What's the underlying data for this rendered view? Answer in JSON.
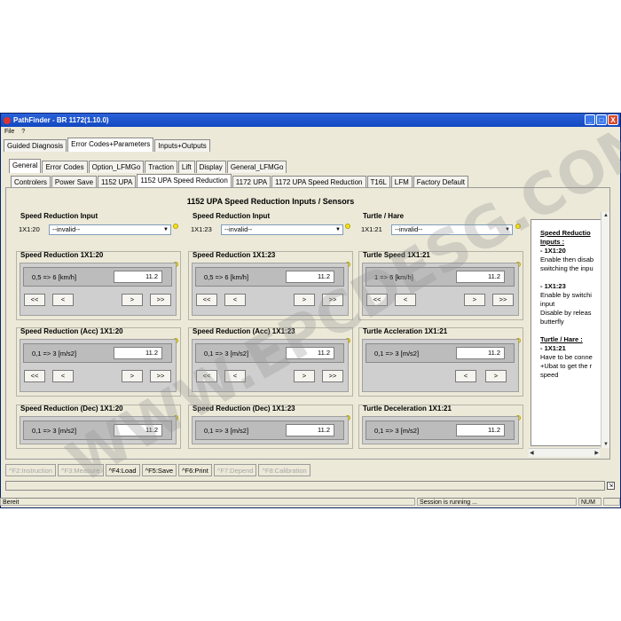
{
  "window": {
    "title": "PathFinder - BR 1172(1.10.0)",
    "buttons": [
      "_",
      "□",
      "X"
    ]
  },
  "menu": [
    "File",
    "?"
  ],
  "top_tabs": [
    "Guided Diagnosis",
    "Error Codes+Parameters",
    "Inputs+Outputs"
  ],
  "second_tabs": [
    "General",
    "Error Codes",
    "Option_LFMGo",
    "Traction",
    "Lift",
    "Display",
    "General_LFMGo"
  ],
  "third_tabs": [
    "Controlers",
    "Power Save",
    "1152 UPA",
    "1152 UPA Speed Reduction",
    "1172 UPA",
    "1172 UPA Speed Reduction",
    "T16L",
    "LFM",
    "Factory Default"
  ],
  "heading": "1152 UPA Speed Reduction Inputs / Sensors",
  "inputs": [
    {
      "title": "Speed Reduction Input",
      "port": "1X1:20",
      "value": "--invalid--"
    },
    {
      "title": "Speed Reduction Input",
      "port": "1X1:23",
      "value": "--invalid--"
    },
    {
      "title": "Turtle / Hare",
      "port": "1X1:21",
      "value": "--invalid--"
    }
  ],
  "panels": [
    {
      "title": "Speed Reduction 1X1:20",
      "range": "0,5 => 6 [km/h]",
      "value": "11.2"
    },
    {
      "title": "Speed Reduction 1X1:23",
      "range": "0,5 => 6 [km/h]",
      "value": "11.2"
    },
    {
      "title": "Turtle Speed 1X1:21",
      "range": "1 => 6 [km/h]",
      "value": "11.2"
    },
    {
      "title": "Speed Reduction (Acc) 1X1:20",
      "range": "0,1 => 3 [m/s2]",
      "value": "11.2"
    },
    {
      "title": "Speed Reduction (Acc) 1X1:23",
      "range": "0,1 => 3 [m/s2]",
      "value": "11.2"
    },
    {
      "title": "Turtle Accleration 1X1:21",
      "range": "0,1 => 3 [m/s2]",
      "value": "11.2"
    },
    {
      "title": "Speed Reduction (Dec) 1X1:20",
      "range": "0,1 => 3 [m/s2]",
      "value": "11.2"
    },
    {
      "title": "Speed Reduction (Dec) 1X1:23",
      "range": "0,1 => 3 [m/s2]",
      "value": "11.2"
    },
    {
      "title": "Turtle Deceleration 1X1:21",
      "range": "0,1 => 3 [m/s2]",
      "value": "11.2"
    }
  ],
  "nav_buttons": {
    "first": "<<",
    "prev": "<",
    "next": ">",
    "last": ">>"
  },
  "help": [
    {
      "text": "Speed Reductio",
      "style": "bold u"
    },
    {
      "text": "Inputs :",
      "style": "bold u"
    },
    {
      "text": "- 1X1:20",
      "style": "bold"
    },
    {
      "text": "Enable then disab",
      "style": ""
    },
    {
      "text": "switching the inpu",
      "style": ""
    },
    {
      "text": "",
      "style": ""
    },
    {
      "text": "- 1X1:23",
      "style": "bold"
    },
    {
      "text": "Enable by switchi",
      "style": ""
    },
    {
      "text": "input",
      "style": ""
    },
    {
      "text": "Disable by releas",
      "style": ""
    },
    {
      "text": "butterfly",
      "style": ""
    },
    {
      "text": "",
      "style": ""
    },
    {
      "text": "Turtle / Hare :",
      "style": "bold u"
    },
    {
      "text": "- 1X1:21",
      "style": "bold"
    },
    {
      "text": "Have to be conne",
      "style": ""
    },
    {
      "text": "+Ubat to get the r",
      "style": ""
    },
    {
      "text": "speed",
      "style": ""
    }
  ],
  "fkeys": [
    {
      "label": "^F2:Instruction",
      "enabled": false
    },
    {
      "label": "^F3:Measure",
      "enabled": false
    },
    {
      "label": "^F4:Load",
      "enabled": true
    },
    {
      "label": "^F5:Save",
      "enabled": true
    },
    {
      "label": "^F6:Print",
      "enabled": true
    },
    {
      "label": "^F7:Depend",
      "enabled": false
    },
    {
      "label": "^F8:Calibration",
      "enabled": false
    }
  ],
  "status": {
    "left": "Bereit",
    "middle": "Session is running ...",
    "num": "NUM"
  },
  "watermark": "WWW.EPCDESG.COM",
  "colors": {
    "titlebar": "#1247c0",
    "face": "#ece9d8",
    "led": "#f5e31a"
  }
}
